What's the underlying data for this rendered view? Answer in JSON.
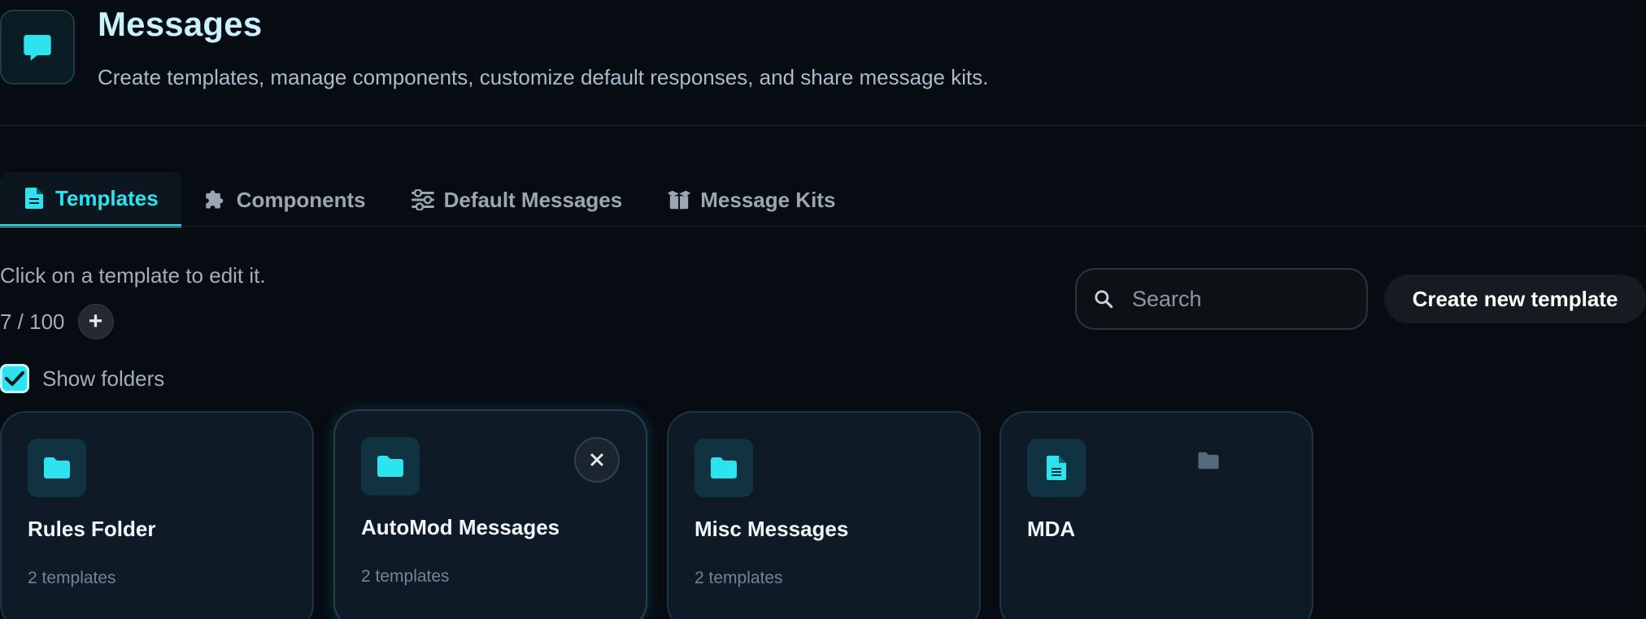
{
  "header": {
    "title": "Messages",
    "subtitle": "Create templates, manage components, customize default responses, and share message kits."
  },
  "tabs": [
    {
      "label": "Templates",
      "icon": "file-icon",
      "active": true
    },
    {
      "label": "Components",
      "icon": "puzzle-icon",
      "active": false
    },
    {
      "label": "Default Messages",
      "icon": "sliders-icon",
      "active": false
    },
    {
      "label": "Message Kits",
      "icon": "box-icon",
      "active": false
    }
  ],
  "main": {
    "hint": "Click on a template to edit it.",
    "count": "7 / 100",
    "add_symbol": "+",
    "show_folders_label": "Show folders",
    "show_folders_checked": true,
    "search_placeholder": "Search",
    "create_label": "Create new template"
  },
  "cards": [
    {
      "title": "Rules Folder",
      "subtitle": "2 templates",
      "icon": "folder-icon"
    },
    {
      "title": "AutoMod Messages",
      "subtitle": "2 templates",
      "icon": "folder-icon",
      "close_icon": "close-icon"
    },
    {
      "title": "Misc Messages",
      "subtitle": "2 templates",
      "icon": "folder-icon"
    },
    {
      "title": "MDA",
      "subtitle": "",
      "icon": "document-icon",
      "secondary_icon": "folder-icon"
    }
  ],
  "colors": {
    "background": "#070b12",
    "accent": "#2de3f0",
    "card_bg": "#0e1b26",
    "muted_text": "#a3aeb9"
  }
}
